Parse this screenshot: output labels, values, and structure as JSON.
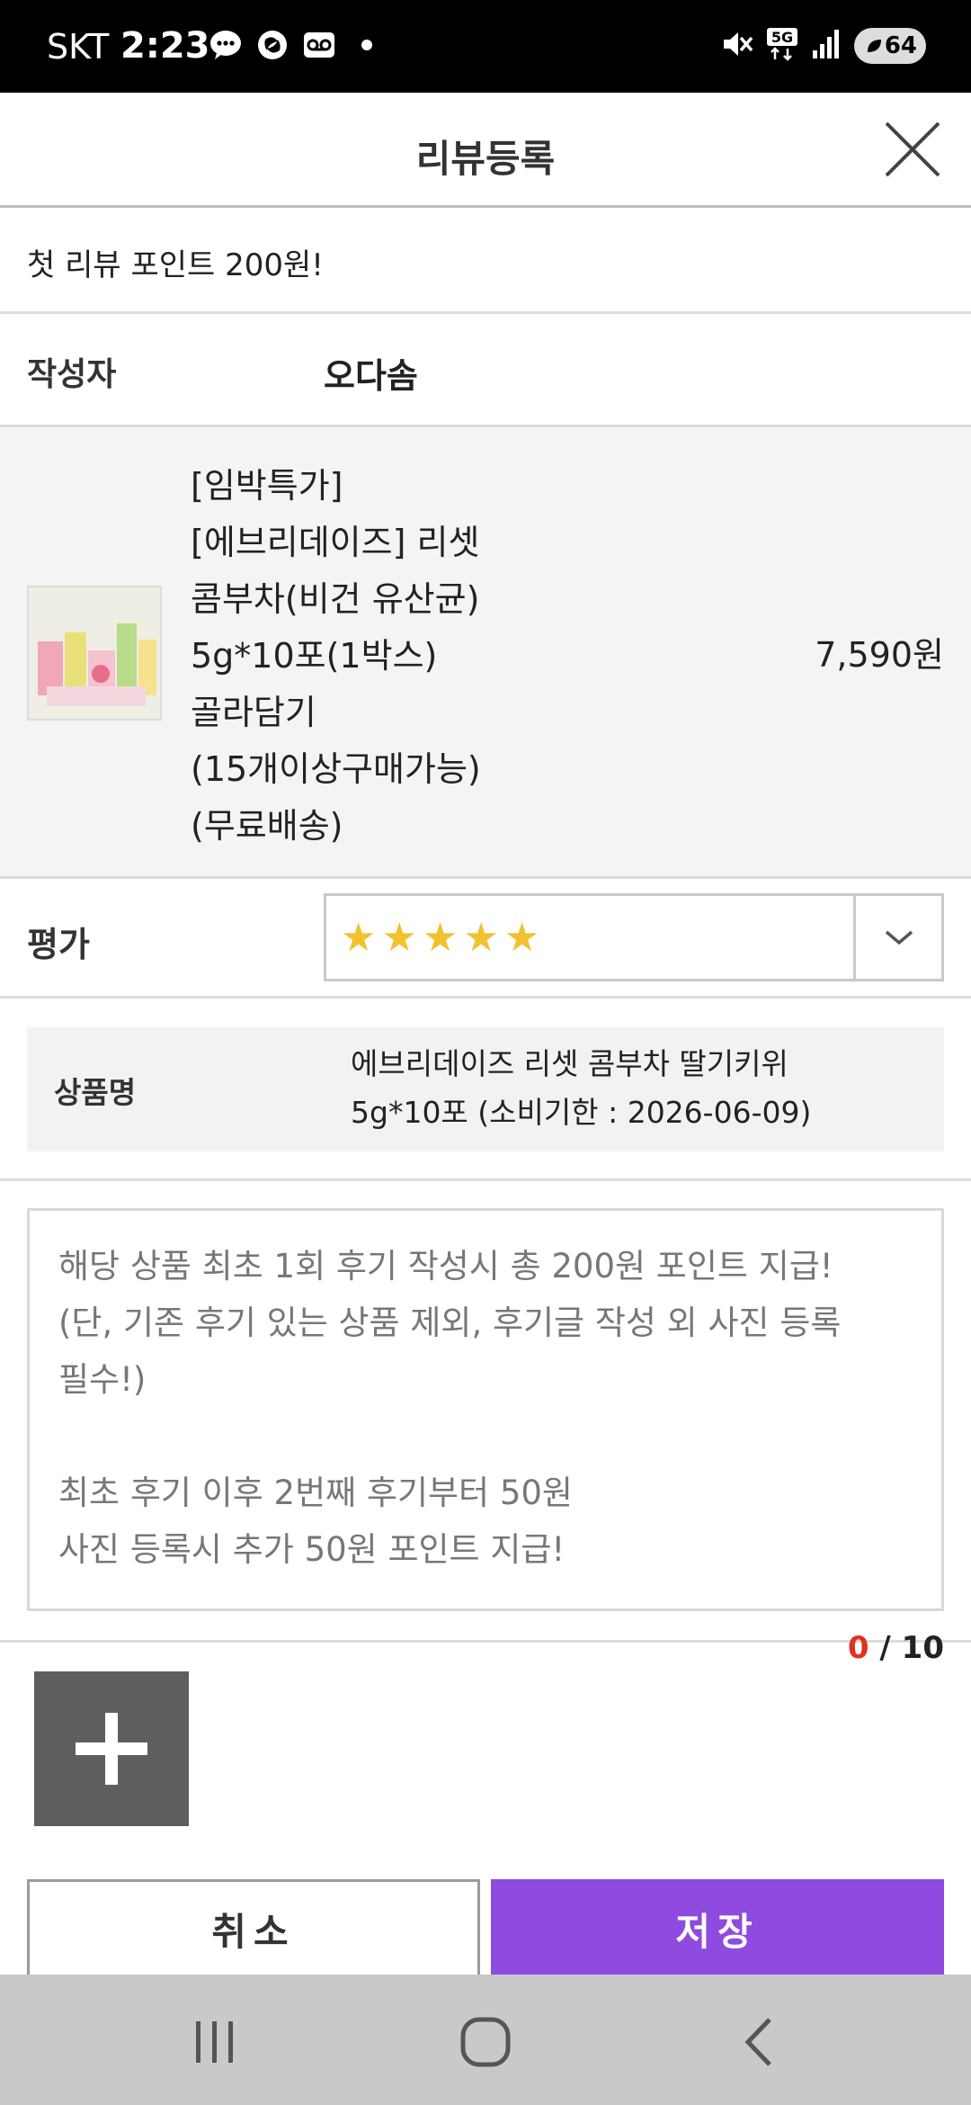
{
  "status_bar": {
    "carrier": "SKT",
    "time": "2:23",
    "network": "5G",
    "battery": "64",
    "icons_left": [
      "chat-bubble-icon",
      "samsung-pay-icon",
      "voicemail-icon"
    ],
    "icons_right": [
      "mute-icon",
      "5g-icon",
      "signal-icon",
      "battery-icon"
    ]
  },
  "header": {
    "title": "리뷰등록"
  },
  "notice": {
    "text": "첫 리뷰 포인트 200원!"
  },
  "author": {
    "label": "작성자",
    "name": "오다솜"
  },
  "product": {
    "name_lines": [
      "[임박특가]",
      "[에브리데이즈] 리셋",
      "콤부차(비건 유산균)",
      "5g*10포(1박스)",
      "골라담기",
      "(15개이상구매가능)",
      "(무료배송)"
    ],
    "price": "7,590원"
  },
  "rating": {
    "label": "평가",
    "stars": 5,
    "max_stars": 5
  },
  "option": {
    "label": "상품명",
    "value_line1": "에브리데이즈 리셋 콤부차 딸기키위",
    "value_line2": "5g*10포 (소비기한 : 2026-06-09)"
  },
  "review_textarea": {
    "placeholder_lines": [
      "해당 상품 최초 1회 후기 작성시 총 200원 포인트 지급!",
      "(단, 기존 후기 있는 상품 제외, 후기글 작성 외 사진 등록",
      "필수!)",
      "",
      "최초 후기 이후 2번째 후기부터 50원",
      "사진 등록시 추가 50원 포인트 지급!"
    ]
  },
  "photo_counter": {
    "current": "0",
    "separator": " / ",
    "max": "10"
  },
  "buttons": {
    "cancel": "취소",
    "save": "저장"
  },
  "colors": {
    "save_button": "#8f4ae0",
    "star": "#f2c12e",
    "counter_current": "#e0321e",
    "add_photo_bg": "#5e5e5e"
  }
}
